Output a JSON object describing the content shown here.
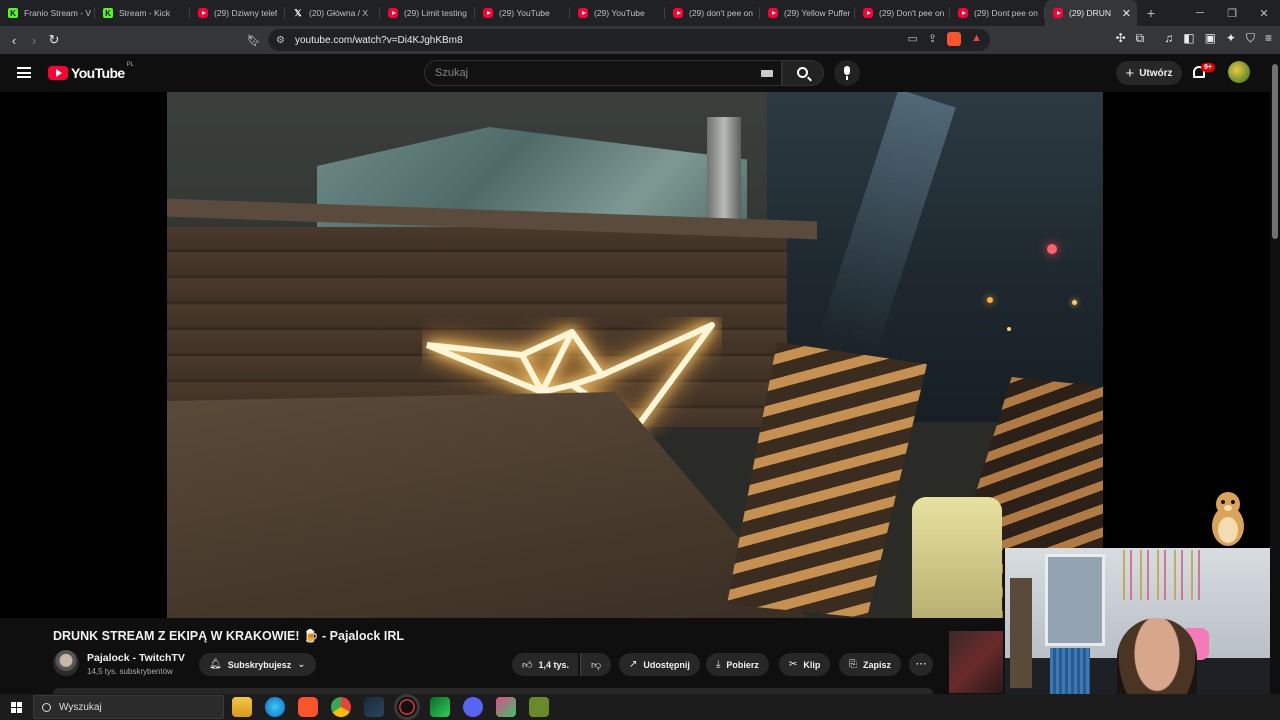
{
  "browser": {
    "tabs": [
      {
        "label": "Franio Stream - V",
        "icon": "kick"
      },
      {
        "label": "Stream - Kick",
        "icon": "kick"
      },
      {
        "label": "(29) Dziwny telef",
        "icon": "youtube"
      },
      {
        "label": "(20) Główna / X",
        "icon": "x"
      },
      {
        "label": "(29) Limit testing",
        "icon": "youtube"
      },
      {
        "label": "(29) YouTube",
        "icon": "youtube"
      },
      {
        "label": "(29) YouTube",
        "icon": "youtube"
      },
      {
        "label": "(29) don't pee on",
        "icon": "youtube"
      },
      {
        "label": "(29) Yellow Puffer",
        "icon": "youtube"
      },
      {
        "label": "(29) Don't pee on",
        "icon": "youtube"
      },
      {
        "label": "(29) Dont pee on",
        "icon": "youtube"
      },
      {
        "label": "(29) DRUN",
        "icon": "youtube",
        "active": true
      }
    ],
    "url": "youtube.com/watch?v=Di4KJghKBm8"
  },
  "youtube": {
    "logo_text": "YouTube",
    "region": "PL",
    "search_placeholder": "Szukaj",
    "create_label": "Utwórz",
    "notif_badge": "9+"
  },
  "video": {
    "title": "DRUNK STREAM Z EKIPĄ W KRAKOWIE! 🍺 - Pajalock IRL",
    "channel_name": "Pajalock - TwitchTV",
    "subscribers": "14,5 tys. subskrybentów",
    "subscribe_label": "Subskrybujesz",
    "likes": "1,4 tys.",
    "share_label": "Udostępnij",
    "download_label": "Pobierz",
    "clip_label": "Klip",
    "save_label": "Zapisz"
  },
  "taskbar": {
    "search_label": "Wyszukaj"
  },
  "colors": {
    "yt_red": "#ff0033",
    "kick_green": "#53fc18",
    "background": "#0f0f0f"
  }
}
